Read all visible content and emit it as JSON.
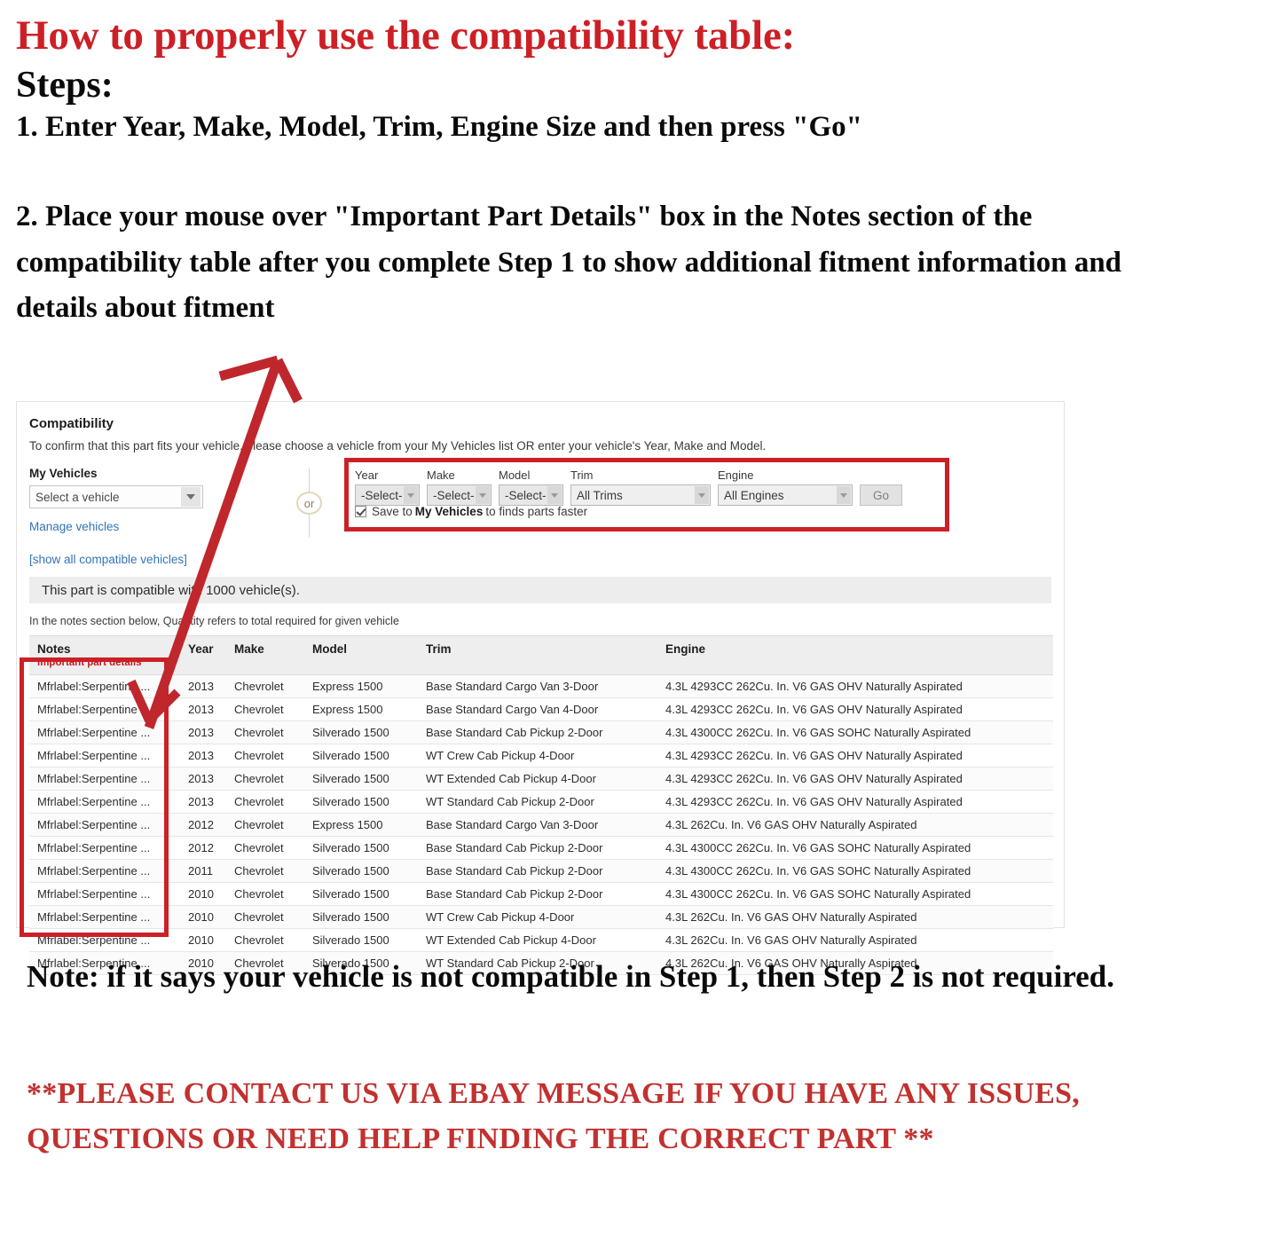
{
  "instructions": {
    "headline": "How to properly use the compatibility table:",
    "steps_label": "Steps:",
    "step1": "1. Enter Year, Make, Model, Trim, Engine Size and then press \"Go\"",
    "step2": "2. Place your mouse over \"Important Part Details\" box in the Notes section of the compatibility table after you complete Step 1 to show additional fitment information and details about fitment"
  },
  "compatibility": {
    "title": "Compatibility",
    "subtitle": "To confirm that this part fits your vehicle, please choose a vehicle from your My Vehicles list OR enter your vehicle's Year, Make and Model.",
    "my_vehicles": {
      "label": "My Vehicles",
      "select_value": "Select a vehicle",
      "manage_link": "Manage vehicles",
      "show_all_link": "[show all compatible vehicles]"
    },
    "or_separator": "or",
    "selector": {
      "fields": [
        {
          "label": "Year",
          "value": "-Select-"
        },
        {
          "label": "Make",
          "value": "-Select-"
        },
        {
          "label": "Model",
          "value": "-Select-"
        },
        {
          "label": "Trim",
          "value": "All Trims"
        },
        {
          "label": "Engine",
          "value": "All Engines"
        }
      ],
      "go_label": "Go",
      "save_prefix": "Save to",
      "save_bold": "My Vehicles",
      "save_suffix": "to finds parts faster"
    },
    "banner": "This part is compatible with 1000 vehicle(s).",
    "quantity_note": "In the notes section below, Quantity refers to total required for given vehicle",
    "table": {
      "headers": {
        "notes": "Notes",
        "notes_sub": "Important part details",
        "year": "Year",
        "make": "Make",
        "model": "Model",
        "trim": "Trim",
        "engine": "Engine"
      },
      "rows": [
        {
          "notes": "Mfrlabel:Serpentine ...",
          "year": "2013",
          "make": "Chevrolet",
          "model": "Express 1500",
          "trim": "Base Standard Cargo Van 3-Door",
          "engine": "4.3L 4293CC 262Cu. In. V6 GAS OHV Naturally Aspirated"
        },
        {
          "notes": "Mfrlabel:Serpentine ...",
          "year": "2013",
          "make": "Chevrolet",
          "model": "Express 1500",
          "trim": "Base Standard Cargo Van 4-Door",
          "engine": "4.3L 4293CC 262Cu. In. V6 GAS OHV Naturally Aspirated"
        },
        {
          "notes": "Mfrlabel:Serpentine ...",
          "year": "2013",
          "make": "Chevrolet",
          "model": "Silverado 1500",
          "trim": "Base Standard Cab Pickup 2-Door",
          "engine": "4.3L 4300CC 262Cu. In. V6 GAS SOHC Naturally Aspirated"
        },
        {
          "notes": "Mfrlabel:Serpentine ...",
          "year": "2013",
          "make": "Chevrolet",
          "model": "Silverado 1500",
          "trim": "WT Crew Cab Pickup 4-Door",
          "engine": "4.3L 4293CC 262Cu. In. V6 GAS OHV Naturally Aspirated"
        },
        {
          "notes": "Mfrlabel:Serpentine ...",
          "year": "2013",
          "make": "Chevrolet",
          "model": "Silverado 1500",
          "trim": "WT Extended Cab Pickup 4-Door",
          "engine": "4.3L 4293CC 262Cu. In. V6 GAS OHV Naturally Aspirated"
        },
        {
          "notes": "Mfrlabel:Serpentine ...",
          "year": "2013",
          "make": "Chevrolet",
          "model": "Silverado 1500",
          "trim": "WT Standard Cab Pickup 2-Door",
          "engine": "4.3L 4293CC 262Cu. In. V6 GAS OHV Naturally Aspirated"
        },
        {
          "notes": "Mfrlabel:Serpentine ...",
          "year": "2012",
          "make": "Chevrolet",
          "model": "Express 1500",
          "trim": "Base Standard Cargo Van 3-Door",
          "engine": "4.3L 262Cu. In. V6 GAS OHV Naturally Aspirated"
        },
        {
          "notes": "Mfrlabel:Serpentine ...",
          "year": "2012",
          "make": "Chevrolet",
          "model": "Silverado 1500",
          "trim": "Base Standard Cab Pickup 2-Door",
          "engine": "4.3L 4300CC 262Cu. In. V6 GAS SOHC Naturally Aspirated"
        },
        {
          "notes": "Mfrlabel:Serpentine ...",
          "year": "2011",
          "make": "Chevrolet",
          "model": "Silverado 1500",
          "trim": "Base Standard Cab Pickup 2-Door",
          "engine": "4.3L 4300CC 262Cu. In. V6 GAS SOHC Naturally Aspirated"
        },
        {
          "notes": "Mfrlabel:Serpentine ...",
          "year": "2010",
          "make": "Chevrolet",
          "model": "Silverado 1500",
          "trim": "Base Standard Cab Pickup 2-Door",
          "engine": "4.3L 4300CC 262Cu. In. V6 GAS SOHC Naturally Aspirated"
        },
        {
          "notes": "Mfrlabel:Serpentine ...",
          "year": "2010",
          "make": "Chevrolet",
          "model": "Silverado 1500",
          "trim": "WT Crew Cab Pickup 4-Door",
          "engine": "4.3L 262Cu. In. V6 GAS OHV Naturally Aspirated"
        },
        {
          "notes": "Mfrlabel:Serpentine ...",
          "year": "2010",
          "make": "Chevrolet",
          "model": "Silverado 1500",
          "trim": "WT Extended Cab Pickup 4-Door",
          "engine": "4.3L 262Cu. In. V6 GAS OHV Naturally Aspirated"
        },
        {
          "notes": "Mfrlabel:Serpentine ...",
          "year": "2010",
          "make": "Chevrolet",
          "model": "Silverado 1500",
          "trim": "WT Standard Cab Pickup 2-Door",
          "engine": "4.3L 262Cu. In. V6 GAS OHV Naturally Aspirated"
        }
      ]
    }
  },
  "footer": {
    "note": "Note: if it says your vehicle is not compatible in Step 1, then Step 2 is not required.",
    "contact": "**PLEASE CONTACT US VIA EBAY MESSAGE IF YOU HAVE ANY ISSUES, QUESTIONS OR NEED HELP FINDING THE CORRECT PART **"
  },
  "colors": {
    "accent_red": "#cc2026",
    "link_blue": "#3174b8",
    "annotation_red": "#c0272d"
  }
}
